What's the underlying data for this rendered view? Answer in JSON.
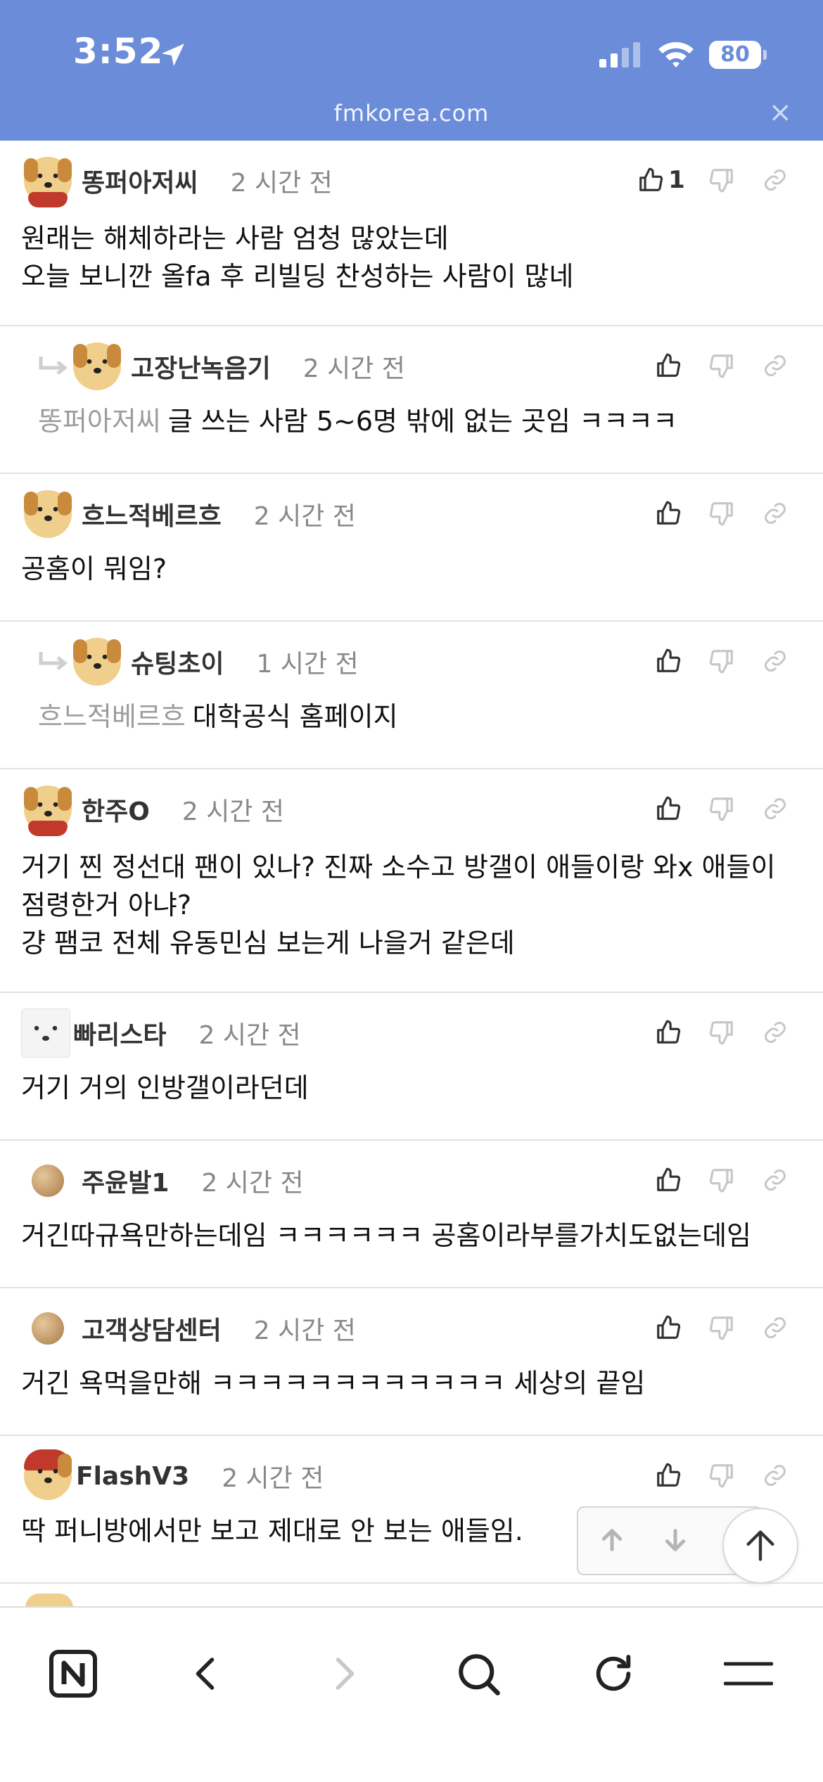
{
  "status_bar": {
    "time": "3:52",
    "battery": "80",
    "icons": [
      "location-arrow-icon",
      "signal-icon",
      "wifi-icon",
      "battery-icon"
    ]
  },
  "url_bar": {
    "domain": "fmkorea.com",
    "close": "×"
  },
  "colors": {
    "header_bg": "#6a8cd9",
    "muted": "#9c9c9c",
    "divider": "#e3e3e3"
  },
  "comments": [
    {
      "user": "똥퍼아저씨",
      "time": "2 시간 전",
      "likes": "1",
      "reply": false,
      "mention": "",
      "lines": [
        "원래는 해체하라는 사람 엄청 많았는데",
        "오늘 보니깐 올fa 후 리빌딩 찬성하는 사람이 많네"
      ]
    },
    {
      "user": "고장난녹음기",
      "time": "2 시간 전",
      "likes": "",
      "reply": true,
      "mention": "똥퍼아저씨",
      "lines": [
        "글 쓰는 사람 5~6명 밖에 없는 곳임 ㅋㅋㅋㅋ"
      ]
    },
    {
      "user": "흐느적베르흐",
      "time": "2 시간 전",
      "likes": "",
      "reply": false,
      "mention": "",
      "lines": [
        "공홈이 뭐임?"
      ]
    },
    {
      "user": "슈팅초이",
      "time": "1 시간 전",
      "likes": "",
      "reply": true,
      "mention": "흐느적베르흐",
      "lines": [
        "대학공식 홈페이지"
      ]
    },
    {
      "user": "한주O",
      "time": "2 시간 전",
      "likes": "",
      "reply": false,
      "mention": "",
      "lines": [
        "거기 찐 정선대 팬이 있나? 진짜 소수고 방갤이 애들이랑 와x 애들이",
        "점령한거 아냐?",
        "걍 팸코 전체 유동민심 보는게 나을거 같은데"
      ]
    },
    {
      "user": "빠리스타",
      "time": "2 시간 전",
      "likes": "",
      "reply": false,
      "mention": "",
      "lines": [
        "거기 거의 인방갤이라던데"
      ]
    },
    {
      "user": "주윤발1",
      "time": "2 시간 전",
      "likes": "",
      "reply": false,
      "mention": "",
      "lines": [
        "거긴따규욕만하는데임 ㅋㅋㅋㅋㅋㅋ 공홈이라부를가치도없는데임"
      ]
    },
    {
      "user": "고객상담센터",
      "time": "2 시간 전",
      "likes": "",
      "reply": false,
      "mention": "",
      "lines": [
        "거긴 욕먹을만해 ㅋㅋㅋㅋㅋㅋㅋㅋㅋㅋㅋㅋ 세상의 끝임"
      ]
    },
    {
      "user": "FlashV3",
      "time": "2 시간 전",
      "likes": "",
      "reply": false,
      "mention": "",
      "lines": [
        "딱 퍼니방에서만 보고 제대로 안 보는 애들임."
      ]
    }
  ],
  "toolbar": {
    "items": [
      "naver-home-icon",
      "back-icon",
      "forward-icon",
      "search-icon",
      "reload-icon",
      "menu-icon"
    ]
  }
}
